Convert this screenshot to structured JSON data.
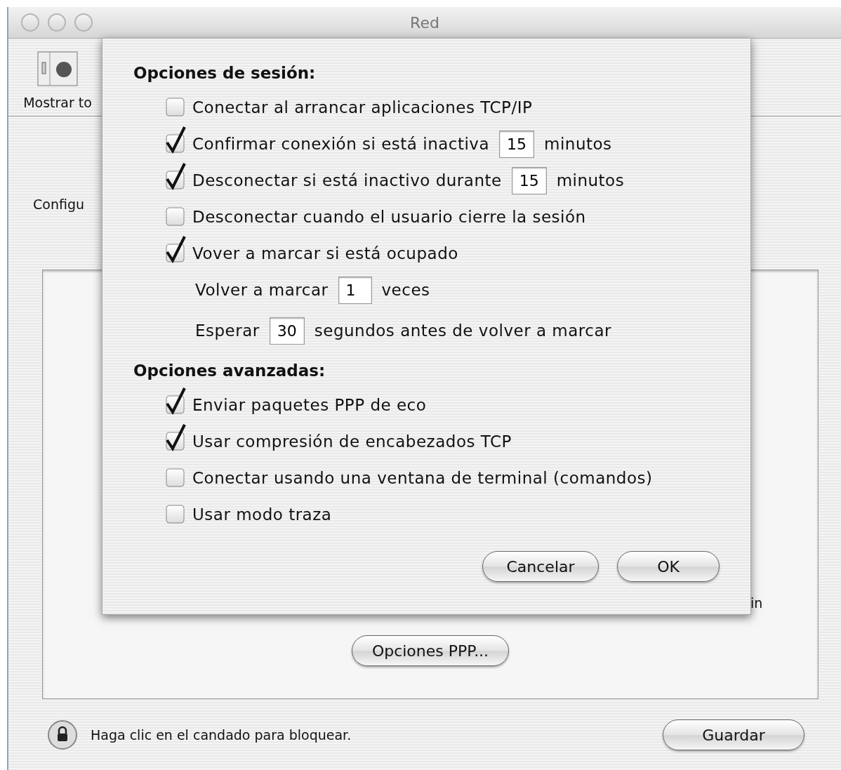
{
  "window": {
    "title": "Red"
  },
  "toolbar": {
    "show_all_label": "Mostrar to"
  },
  "background": {
    "configure_label": "Configu",
    "panel_fragment": "in",
    "ppp_button": "Opciones PPP...",
    "lock_text": "Haga clic en el candado para bloquear.",
    "save_button": "Guardar"
  },
  "sheet": {
    "sections": [
      {
        "heading": "Opciones de sesión:",
        "rows": [
          {
            "kind": "check",
            "checked": false,
            "label": "Conectar al arrancar aplicaciones TCP/IP"
          },
          {
            "kind": "check",
            "checked": true,
            "label": "Confirmar conexión si está inactiva",
            "value": "15",
            "suffix": "minutos"
          },
          {
            "kind": "check",
            "checked": true,
            "label": "Desconectar si está inactivo durante",
            "value": "15",
            "suffix": "minutos"
          },
          {
            "kind": "check",
            "checked": false,
            "label": "Desconectar cuando el usuario cierre la sesión"
          },
          {
            "kind": "check",
            "checked": true,
            "label": "Vover a marcar si está ocupado"
          },
          {
            "kind": "field",
            "label": "Volver a marcar",
            "value": "1",
            "suffix": "veces"
          },
          {
            "kind": "field",
            "label": "Esperar",
            "value": "30",
            "suffix": "segundos antes de volver a marcar"
          }
        ]
      },
      {
        "heading": "Opciones avanzadas:",
        "rows": [
          {
            "kind": "check",
            "checked": true,
            "label": "Enviar paquetes PPP de eco"
          },
          {
            "kind": "check",
            "checked": true,
            "label": "Usar compresión de encabezados TCP"
          },
          {
            "kind": "check",
            "checked": false,
            "label": "Conectar usando una ventana de terminal (comandos)"
          },
          {
            "kind": "check",
            "checked": false,
            "label": "Usar modo traza"
          }
        ]
      }
    ],
    "buttons": [
      "Cancelar",
      "OK"
    ]
  }
}
